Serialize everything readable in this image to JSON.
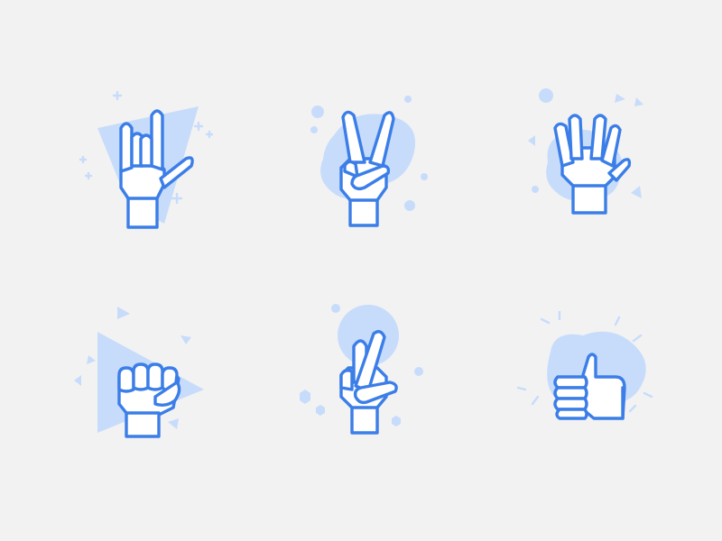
{
  "colors": {
    "background": "#f2f2f2",
    "stroke": "#3b7ee8",
    "accent_fill": "#c7dcfb",
    "hand_fill": "#ffffff"
  },
  "icons": [
    {
      "name": "rock-on-hand-icon"
    },
    {
      "name": "peace-sign-hand-icon"
    },
    {
      "name": "vulcan-salute-hand-icon"
    },
    {
      "name": "raised-fist-icon"
    },
    {
      "name": "crossed-fingers-hand-icon"
    },
    {
      "name": "thumbs-up-hand-icon"
    }
  ]
}
